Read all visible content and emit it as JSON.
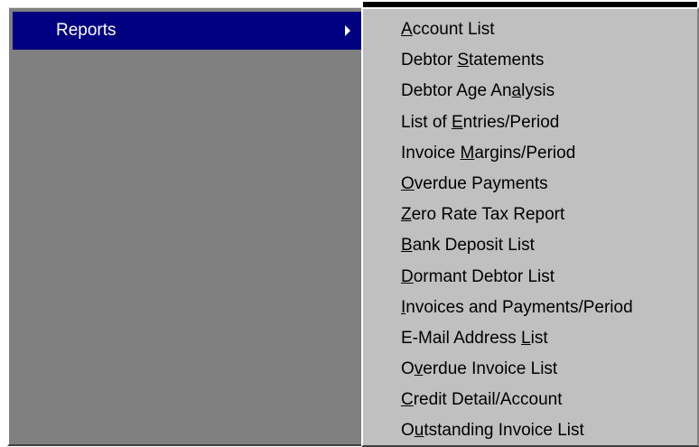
{
  "parent_menu": {
    "items": [
      {
        "label": "Reports",
        "accel": "R",
        "selected": true,
        "has_submenu": true
      }
    ]
  },
  "submenu": {
    "items": [
      {
        "label": "Account List",
        "accel_index": 0
      },
      {
        "label": "Debtor Statements",
        "accel_index": 7
      },
      {
        "label": "Debtor Age Analysis",
        "accel_index": 13
      },
      {
        "label": "List of Entries/Period",
        "accel_index": 8
      },
      {
        "label": "Invoice Margins/Period",
        "accel_index": 8
      },
      {
        "label": "Overdue Payments",
        "accel_index": 0
      },
      {
        "label": "Zero Rate Tax Report",
        "accel_index": 0
      },
      {
        "label": "Bank Deposit List",
        "accel_index": 0
      },
      {
        "label": "Dormant Debtor List",
        "accel_index": 0
      },
      {
        "label": "Invoices and Payments/Period",
        "accel_index": 0
      },
      {
        "label": "E-Mail Address List",
        "accel_index": 15
      },
      {
        "label": "Overdue Invoice List",
        "accel_index": 1
      },
      {
        "label": "Credit Detail/Account",
        "accel_index": 0
      },
      {
        "label": "Outstanding Invoice List",
        "accel_index": 1
      }
    ]
  },
  "colors": {
    "highlight": "#000080",
    "menu_face": "#c0c0c0",
    "parent_bg": "#808080"
  }
}
